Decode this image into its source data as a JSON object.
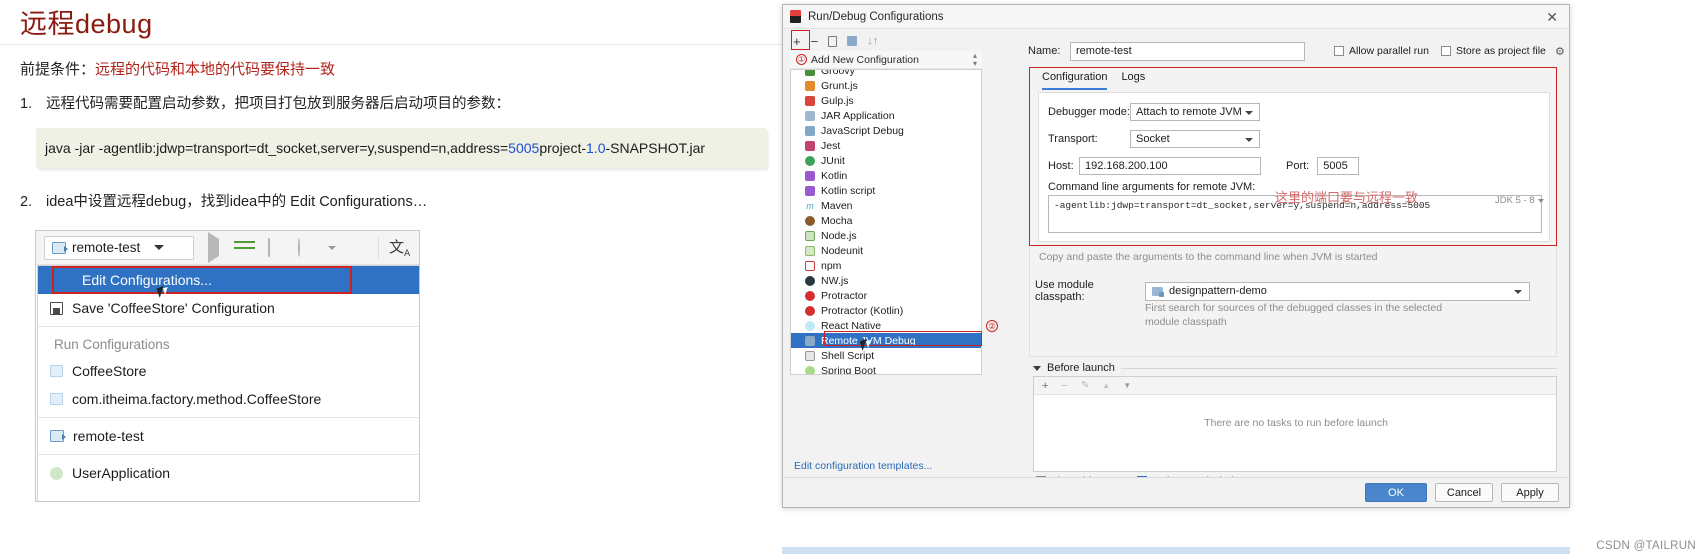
{
  "doc": {
    "title": "远程debug",
    "prereq_label": "前提条件：",
    "prereq_value": "远程的代码和本地的代码要保持一致",
    "step1_num": "1.",
    "step1_text": "远程代码需要配置启动参数，把项目打包放到服务器后启动项目的参数：",
    "code": {
      "part1": "java -jar -agentlib:jdwp=transport=dt_socket,server=y,suspend=n,address=",
      "port": "5005",
      "part2": " project-",
      "version": "1.0",
      "part3": "-SNAPSHOT.jar"
    },
    "step2_num": "2.",
    "step2_text": "idea中设置远程debug，找到idea中的 Edit Configurations…"
  },
  "idea_menu": {
    "selector_label": "remote-test",
    "selected_item": "Edit Configurations...",
    "save_item": "Save 'CoffeeStore' Configuration",
    "group_header": "Run Configurations",
    "items": [
      {
        "label": "CoffeeStore",
        "icon": "class-icon"
      },
      {
        "label": "com.itheima.factory.method.CoffeeStore",
        "icon": "class-icon"
      },
      {
        "label": "remote-test",
        "icon": "remote-debug-icon"
      },
      {
        "label": "UserApplication",
        "icon": "spring-icon"
      }
    ]
  },
  "dialog": {
    "title": "Run/Debug Configurations",
    "close_label": "✕",
    "toolbar": {
      "add": "+",
      "remove": "−",
      "copy": "copy-icon",
      "save": "save-icon",
      "sort": "sort-icon"
    },
    "add_new_configuration": "Add New Configuration",
    "marker1": "①",
    "marker2": "②",
    "marker3": "③",
    "type_list": [
      {
        "label": "Groovy",
        "color": "#4a8f3c"
      },
      {
        "label": "Grunt.js",
        "color": "#e08a2b"
      },
      {
        "label": "Gulp.js",
        "color": "#d9453c"
      },
      {
        "label": "JAR Application",
        "color": "#9fb8cf"
      },
      {
        "label": "JavaScript Debug",
        "color": "#7fa8c9"
      },
      {
        "label": "Jest",
        "color": "#c2446e"
      },
      {
        "label": "JUnit",
        "color": "#3fa05a"
      },
      {
        "label": "Kotlin",
        "color": "#9b59d0"
      },
      {
        "label": "Kotlin script",
        "color": "#9b59d0"
      },
      {
        "label": "Maven",
        "color": "#3fa3c9"
      },
      {
        "label": "Mocha",
        "color": "#8a5a2b"
      },
      {
        "label": "Node.js",
        "color": "#6fa84f"
      },
      {
        "label": "Nodeunit",
        "color": "#8bb96b"
      },
      {
        "label": "npm",
        "color": "#cb3837"
      },
      {
        "label": "NW.js",
        "color": "#2b3a42"
      },
      {
        "label": "Protractor",
        "color": "#d42f2f"
      },
      {
        "label": "Protractor (Kotlin)",
        "color": "#d42f2f"
      },
      {
        "label": "React Native",
        "color": "#61dafb"
      },
      {
        "label": "Remote JVM Debug",
        "color": "#8aa9c6",
        "selected": true
      },
      {
        "label": "Shell Script",
        "color": "#9a9a9a"
      },
      {
        "label": "Spring Boot",
        "color": "#6db33f"
      }
    ],
    "edit_templates_link": "Edit configuration templates...",
    "help_label": "?",
    "name_label": "Name:",
    "name_value": "remote-test",
    "allow_parallel_run": "Allow parallel run",
    "store_as_project_file": "Store as project file",
    "tabs": [
      {
        "label": "Configuration",
        "active": true
      },
      {
        "label": "Logs",
        "active": false
      }
    ],
    "debugger_mode_label": "Debugger mode:",
    "debugger_mode_value": "Attach to remote JVM",
    "transport_label": "Transport:",
    "transport_value": "Socket",
    "host_label": "Host:",
    "host_value": "192.168.200.100",
    "port_label": "Port:",
    "port_value": "5005",
    "cmdline_label": "Command line arguments for remote JVM:",
    "cmdline_value": "-agentlib:jdwp=transport=dt_socket,server=y,suspend=n,address=5005",
    "port_note": "这里的端口要与远程一致",
    "jdk_note": "JDK 5 - 8",
    "copy_hint": "Copy and paste the arguments to the command line when JVM is started",
    "module_classpath_label": "Use module classpath:",
    "module_classpath_value": "designpattern-demo",
    "module_hint_line1": "First search for sources of the debugged classes in the selected",
    "module_hint_line2": "module classpath",
    "before_launch_label": "Before launch",
    "before_launch_tools": [
      "+",
      "−",
      "✎",
      "▲",
      "▼"
    ],
    "before_launch_empty": "There are no tasks to run before launch",
    "show_this_page": "Show this page",
    "activate_tool_window": "Activate tool window",
    "buttons": {
      "ok": "OK",
      "cancel": "Cancel",
      "apply": "Apply"
    }
  },
  "watermark": "CSDN @TAILRUN",
  "colors": {
    "accent_blue": "#2f72c4",
    "annotation_red": "#cc2222",
    "title_red": "#8b1a10",
    "code_bg": "#eef1e4",
    "link_blue": "#2b6ab5"
  }
}
